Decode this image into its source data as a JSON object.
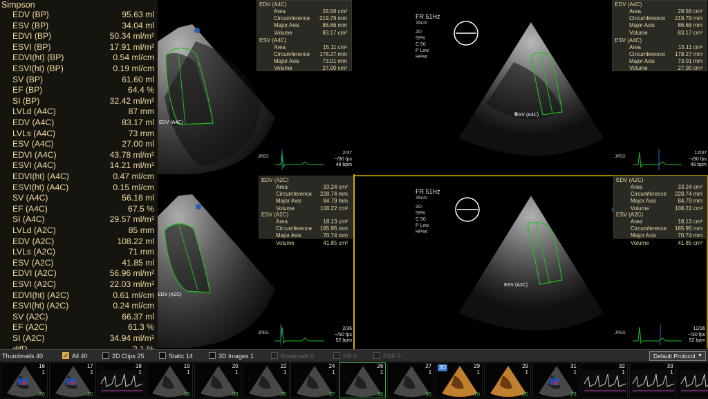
{
  "measurements": {
    "title": "Simpson",
    "rows": [
      {
        "label": "EDV (BP)",
        "value": "95.63",
        "unit": "ml"
      },
      {
        "label": "ESV (BP)",
        "value": "34.04",
        "unit": "ml"
      },
      {
        "label": "EDVI (BP)",
        "value": "50.34",
        "unit": "ml/m²"
      },
      {
        "label": "ESVI (BP)",
        "value": "17.91",
        "unit": "ml/m²"
      },
      {
        "label": "EDVI(ht) (BP)",
        "value": "0.54",
        "unit": "ml/cm"
      },
      {
        "label": "ESVI(ht) (BP)",
        "value": "0.19",
        "unit": "ml/cm"
      },
      {
        "label": "SV (BP)",
        "value": "61.60",
        "unit": "ml"
      },
      {
        "label": "EF (BP)",
        "value": "64.4",
        "unit": "%"
      },
      {
        "label": "SI (BP)",
        "value": "32.42",
        "unit": "ml/m²"
      },
      {
        "label": "LVLd (A4C)",
        "value": "87",
        "unit": "mm"
      },
      {
        "label": "EDV (A4C)",
        "value": "83.17",
        "unit": "ml"
      },
      {
        "label": "LVLs (A4C)",
        "value": "73",
        "unit": "mm"
      },
      {
        "label": "ESV (A4C)",
        "value": "27.00",
        "unit": "ml"
      },
      {
        "label": "EDVI (A4C)",
        "value": "43.78",
        "unit": "ml/m²"
      },
      {
        "label": "ESVI (A4C)",
        "value": "14.21",
        "unit": "ml/m²"
      },
      {
        "label": "EDVI(ht) (A4C)",
        "value": "0.47",
        "unit": "ml/cm"
      },
      {
        "label": "ESVI(ht) (A4C)",
        "value": "0.15",
        "unit": "ml/cm"
      },
      {
        "label": "SV (A4C)",
        "value": "56.18",
        "unit": "ml"
      },
      {
        "label": "EF (A4C)",
        "value": "67.5",
        "unit": "%"
      },
      {
        "label": "SI (A4C)",
        "value": "29.57",
        "unit": "ml/m²"
      },
      {
        "label": "LVLd (A2C)",
        "value": "85",
        "unit": "mm"
      },
      {
        "label": "EDV (A2C)",
        "value": "108.22",
        "unit": "ml"
      },
      {
        "label": "LVLs (A2C)",
        "value": "71",
        "unit": "mm"
      },
      {
        "label": "ESV (A2C)",
        "value": "41.85",
        "unit": "ml"
      },
      {
        "label": "EDVI (A2C)",
        "value": "56.96",
        "unit": "ml/m²"
      },
      {
        "label": "ESVI (A2C)",
        "value": "22.03",
        "unit": "ml/m²"
      },
      {
        "label": "EDVI(ht) (A2C)",
        "value": "0.61",
        "unit": "ml/cm"
      },
      {
        "label": "ESVI(ht) (A2C)",
        "value": "0.24",
        "unit": "ml/cm"
      },
      {
        "label": "SV (A2C)",
        "value": "66.37",
        "unit": "ml"
      },
      {
        "label": "EF (A2C)",
        "value": "61.3",
        "unit": "%"
      },
      {
        "label": "SI (A2C)",
        "value": "34.94",
        "unit": "ml/m²"
      },
      {
        "label": "difD",
        "value": "2.1",
        "unit": "%"
      }
    ]
  },
  "viewports": {
    "tl": {
      "trace_label": "EDV (A4C)",
      "frame": "2/37",
      "fps": "~/30 fps",
      "bpm": "49 bpm",
      "jpeg": "JPEG"
    },
    "tr": {
      "header_fr": "FR 51Hz",
      "header_depth": "16cm",
      "header_lines": [
        "2D",
        "59%",
        "C 50",
        "P Low",
        "HPen"
      ],
      "zoom_label": "0",
      "trace_label": "ESV (A4C)",
      "frame": "12/37",
      "fps": "~/30 fps",
      "bpm": "49 bpm",
      "jpeg": "JPEG",
      "box": {
        "edv_title": "EDV (A4C)",
        "edv": [
          [
            "Area",
            "29.56 cm²"
          ],
          [
            "Circumference",
            "219.79 mm"
          ],
          [
            "Major Axis",
            "86.66 mm"
          ],
          [
            "Volume",
            "83.17 cm³"
          ]
        ],
        "esv_title": "ESV (A4C)",
        "esv": [
          [
            "Area",
            "15.11 cm²"
          ],
          [
            "Circumference",
            "178.27 mm"
          ],
          [
            "Major Axis",
            "73.01 mm"
          ],
          [
            "Volume",
            "27.00 cm³"
          ]
        ]
      }
    },
    "tl_box": {
      "edv_title": "EDV (A4C)",
      "edv": [
        [
          "Area",
          "29.56 cm²"
        ],
        [
          "Circumference",
          "219.79 mm"
        ],
        [
          "Major Axis",
          "86.66 mm"
        ],
        [
          "Volume",
          "83.17 cm³"
        ]
      ],
      "esv_title": "ESV (A4C)",
      "esv": [
        [
          "Area",
          "15.11 cm²"
        ],
        [
          "Circumference",
          "178.27 mm"
        ],
        [
          "Major Axis",
          "73.01 mm"
        ],
        [
          "Volume",
          "27.00 cm³"
        ]
      ]
    },
    "bl": {
      "trace_label": "EDV (A2C)",
      "frame": "2/36",
      "fps": "~/30 fps",
      "bpm": "52 bpm",
      "jpeg": "JPEG",
      "box": {
        "edv_title": "EDV (A2C)",
        "edv": [
          [
            "Area",
            "33.24 cm²"
          ],
          [
            "Circumference",
            "228.74 mm"
          ],
          [
            "Major Axis",
            "84.79 mm"
          ],
          [
            "Volume",
            "108.22 cm³"
          ]
        ],
        "esv_title": "ESV (A2C)",
        "esv": [
          [
            "Area",
            "18.13 cm²"
          ],
          [
            "Circumference",
            "185.95 mm"
          ],
          [
            "Major Axis",
            "70.74 mm"
          ],
          [
            "Volume",
            "41.85 cm³"
          ]
        ]
      }
    },
    "br": {
      "header_fr": "FR 51Hz",
      "header_depth": "16cm",
      "header_lines": [
        "2D",
        "59%",
        "C 50",
        "P Low",
        "HPen"
      ],
      "zoom_label": "0",
      "trace_label": "ESV (A2C)",
      "frame": "12/36",
      "fps": "~/30 fps",
      "bpm": "52 bpm",
      "jpeg": "JPEG",
      "box": {
        "edv_title": "EDV (A2C)",
        "edv": [
          [
            "Area",
            "33.24 cm²"
          ],
          [
            "Circumference",
            "228.74 mm"
          ],
          [
            "Major Axis",
            "84.79 mm"
          ],
          [
            "Volume",
            "108.22 cm³"
          ]
        ],
        "esv_title": "ESV (A2C)",
        "esv": [
          [
            "Area",
            "18.13 cm²"
          ],
          [
            "Circumference",
            "185.95 mm"
          ],
          [
            "Major Axis",
            "70.74 mm"
          ],
          [
            "Volume",
            "41.85 cm³"
          ]
        ]
      }
    }
  },
  "toolbar": {
    "thumbnails_label": "Thumbnails 40",
    "filters": [
      {
        "label": "All",
        "count": "40",
        "checked": true,
        "enabled": true
      },
      {
        "label": "2D Clips",
        "count": "25",
        "checked": false,
        "enabled": true
      },
      {
        "label": "Static",
        "count": "14",
        "checked": false,
        "enabled": true
      },
      {
        "label": "3D Images",
        "count": "1",
        "checked": false,
        "enabled": true
      },
      {
        "label": "Bookmark",
        "count": "0",
        "checked": false,
        "enabled": false
      },
      {
        "label": "SR",
        "count": "0",
        "checked": false,
        "enabled": false
      },
      {
        "label": "PDF",
        "count": "0",
        "checked": false,
        "enabled": false
      }
    ],
    "protocol": "Default Protocol"
  },
  "thumbnails": [
    {
      "num": "16",
      "frames": "20",
      "kind": "color"
    },
    {
      "num": "17",
      "frames": "20",
      "kind": "color"
    },
    {
      "num": "18",
      "frames": "",
      "kind": "doppler"
    },
    {
      "num": "19",
      "frames": "36",
      "kind": "gray"
    },
    {
      "num": "20",
      "frames": "33",
      "kind": "gray"
    },
    {
      "num": "22",
      "frames": "35",
      "kind": "gray"
    },
    {
      "num": "24",
      "frames": "37",
      "kind": "gray"
    },
    {
      "num": "26",
      "frames": "36",
      "kind": "gray",
      "selected": true
    },
    {
      "num": "27",
      "frames": "36",
      "kind": "gray"
    },
    {
      "num": "29",
      "frames": "20",
      "kind": "3d",
      "badge": "3D"
    },
    {
      "num": "29",
      "frames": "20",
      "kind": "3d"
    },
    {
      "num": "31",
      "frames": "23",
      "kind": "color"
    },
    {
      "num": "32",
      "frames": "",
      "kind": "doppler"
    },
    {
      "num": "33",
      "frames": "",
      "kind": "doppler"
    },
    {
      "num": "34",
      "frames": "",
      "kind": "doppler"
    }
  ],
  "colors": {
    "accent_yellow": "#d4b400",
    "trace_green": "#22c022",
    "panel_text": "#f2dba2",
    "frames_green": "#4caf50"
  }
}
